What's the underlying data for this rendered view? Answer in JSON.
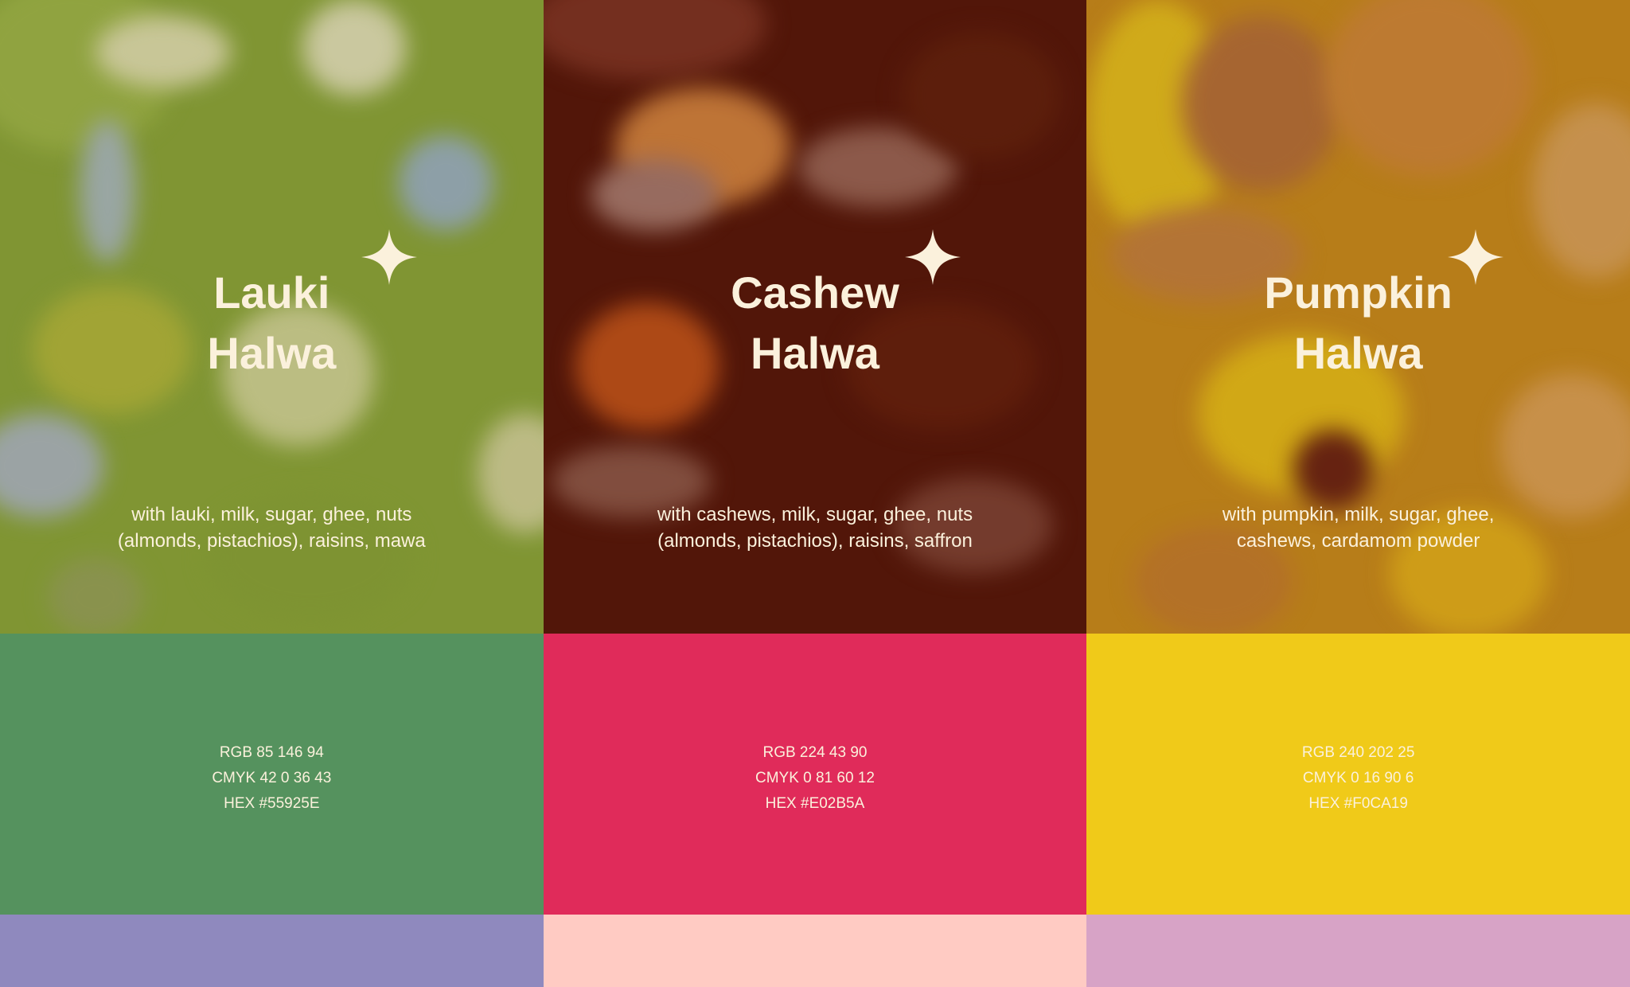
{
  "columns": [
    {
      "id": "lauki",
      "title_line1": "Lauki",
      "title_line2": "Halwa",
      "desc_line1": "with lauki, milk, sugar, ghee, nuts",
      "desc_line2": "(almonds, pistachios), raisins, mawa",
      "rgb": "RGB 85 146 94",
      "cmyk": "CMYK 42 0 36 43",
      "hex": "HEX #55925E",
      "swatch_color": "#55925E",
      "accent_color": "#8F89BE",
      "photo_base": "#8fa73a"
    },
    {
      "id": "cashew",
      "title_line1": "Cashew",
      "title_line2": "Halwa",
      "desc_line1": "with cashews, milk, sugar, ghee, nuts",
      "desc_line2": "(almonds, pistachios), raisins, saffron",
      "rgb": "RGB 224 43 90",
      "cmyk": "CMYK 0 81 60 12",
      "hex": "HEX #E02B5A",
      "swatch_color": "#E02B5A",
      "accent_color": "#FFCBC3",
      "photo_base": "#5e1a0c"
    },
    {
      "id": "pumpkin",
      "title_line1": "Pumpkin",
      "title_line2": "Halwa",
      "desc_line1": "with pumpkin, milk, sugar, ghee,",
      "desc_line2": "cashews, cardamom powder",
      "rgb": "RGB 240 202 25",
      "cmyk": "CMYK 0 16 90 6",
      "hex": "HEX #F0CA19",
      "swatch_color": "#F0CA19",
      "accent_color": "#D7A3C6",
      "photo_base": "#c98d1e"
    }
  ],
  "icons": {
    "sparkle": "four-point-star-icon"
  }
}
